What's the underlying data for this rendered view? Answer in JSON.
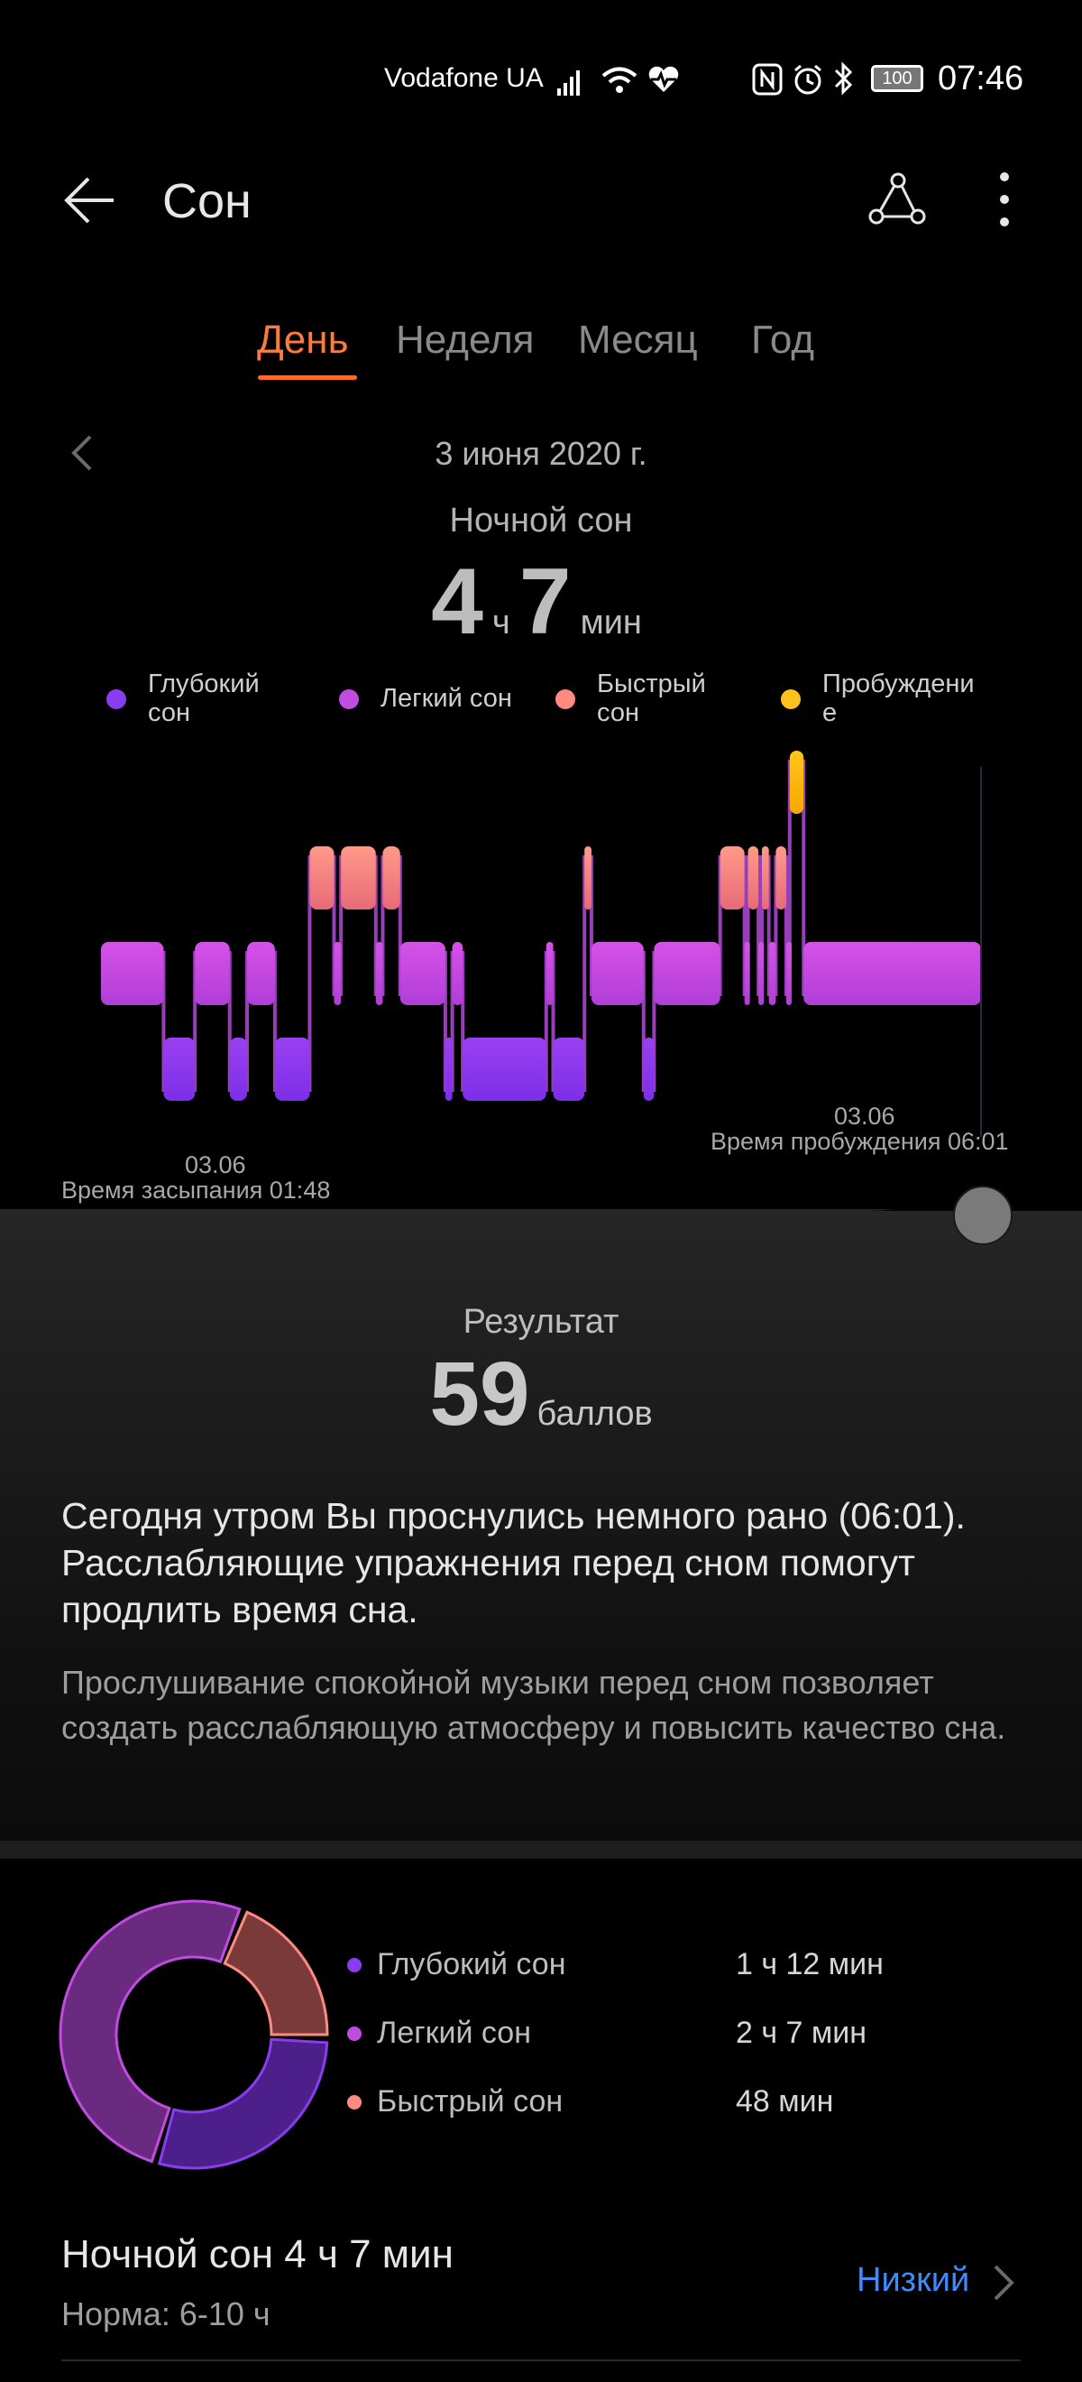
{
  "status_bar": {
    "carrier": "Vodafone UA",
    "battery": "100",
    "time": "07:46",
    "icons": [
      "signal-icon",
      "wifi-icon",
      "heart-rate-icon",
      "nfc-icon",
      "alarm-icon",
      "bluetooth-icon",
      "battery-icon"
    ]
  },
  "header": {
    "title": "Сон"
  },
  "tabs": [
    {
      "label": "День",
      "active": true
    },
    {
      "label": "Неделя",
      "active": false
    },
    {
      "label": "Месяц",
      "active": false
    },
    {
      "label": "Год",
      "active": false
    }
  ],
  "summary": {
    "date": "3 июня 2020 г.",
    "subtitle": "Ночной сон",
    "hours": "4",
    "hours_unit": "ч",
    "minutes": "7",
    "minutes_unit": "мин"
  },
  "legend": [
    {
      "label": "Глубокий сон",
      "color": "#8a3cf0"
    },
    {
      "label": "Легкий сон",
      "color": "#c04ce0"
    },
    {
      "label": "Быстрый сон",
      "color": "#ff8a80"
    },
    {
      "label": "Пробуждение",
      "color": "#ffc21a"
    }
  ],
  "chart_data": {
    "type": "area",
    "title": "",
    "stages": [
      "Пробуждение",
      "Быстрый сон",
      "Легкий сон",
      "Глубокий сон"
    ],
    "start": {
      "date": "03.06",
      "label": "Время засыпания 01:48",
      "time": "01:48"
    },
    "end": {
      "date": "03.06",
      "label": "Время пробуждения 06:01",
      "time": "06:01"
    },
    "segments": [
      {
        "stage": "Легкий сон",
        "from": "01:48",
        "to": "02:06"
      },
      {
        "stage": "Глубокий сон",
        "from": "02:06",
        "to": "02:15"
      },
      {
        "stage": "Легкий сон",
        "from": "02:15",
        "to": "02:25"
      },
      {
        "stage": "Глубокий сон",
        "from": "02:25",
        "to": "02:30"
      },
      {
        "stage": "Легкий сон",
        "from": "02:30",
        "to": "02:38"
      },
      {
        "stage": "Глубокий сон",
        "from": "02:38",
        "to": "02:48"
      },
      {
        "stage": "Быстрый сон",
        "from": "02:48",
        "to": "02:55"
      },
      {
        "stage": "Легкий сон",
        "from": "02:55",
        "to": "02:57"
      },
      {
        "stage": "Быстрый сон",
        "from": "02:57",
        "to": "03:07"
      },
      {
        "stage": "Легкий сон",
        "from": "03:07",
        "to": "03:09"
      },
      {
        "stage": "Быстрый сон",
        "from": "03:09",
        "to": "03:14"
      },
      {
        "stage": "Легкий сон",
        "from": "03:14",
        "to": "03:27"
      },
      {
        "stage": "Глубокий сон",
        "from": "03:27",
        "to": "03:29"
      },
      {
        "stage": "Легкий сон",
        "from": "03:29",
        "to": "03:32"
      },
      {
        "stage": "Глубокий сон",
        "from": "03:32",
        "to": "03:56"
      },
      {
        "stage": "Легкий сон",
        "from": "03:56",
        "to": "03:58"
      },
      {
        "stage": "Глубокий сон",
        "from": "03:58",
        "to": "04:07"
      },
      {
        "stage": "Быстрый сон",
        "from": "04:07",
        "to": "04:09"
      },
      {
        "stage": "Легкий сон",
        "from": "04:09",
        "to": "04:24"
      },
      {
        "stage": "Глубокий сон",
        "from": "04:24",
        "to": "04:27"
      },
      {
        "stage": "Легкий сон",
        "from": "04:27",
        "to": "04:46"
      },
      {
        "stage": "Быстрый сон",
        "from": "04:46",
        "to": "04:53"
      },
      {
        "stage": "Легкий сон",
        "from": "04:53",
        "to": "04:54"
      },
      {
        "stage": "Быстрый сон",
        "from": "04:54",
        "to": "04:57"
      },
      {
        "stage": "Легкий сон",
        "from": "04:57",
        "to": "04:58"
      },
      {
        "stage": "Быстрый сон",
        "from": "04:58",
        "to": "05:00"
      },
      {
        "stage": "Легкий сон",
        "from": "05:00",
        "to": "05:02"
      },
      {
        "stage": "Быстрый сон",
        "from": "05:02",
        "to": "05:05"
      },
      {
        "stage": "Легкий сон",
        "from": "05:05",
        "to": "05:06"
      },
      {
        "stage": "Пробуждение",
        "from": "05:06",
        "to": "05:10"
      },
      {
        "stage": "Легкий сон",
        "from": "05:10",
        "to": "06:01"
      }
    ]
  },
  "result": {
    "label": "Результат",
    "score": "59",
    "unit": "баллов",
    "advice": "Сегодня утром Вы проснулись немного рано (06:01). Расслабляющие упражнения перед сном помогут продлить время сна.",
    "tip": "Прослушивание спокойной музыки перед сном позволяет создать расслабляющую атмосферу и повысить качество сна."
  },
  "breakdown": [
    {
      "label": "Глубокий сон",
      "value": "1 ч 12 мин",
      "minutes": 72,
      "color": "#8a3cf0",
      "ring": "#4d1f8a"
    },
    {
      "label": "Легкий сон",
      "value": "2 ч 7 мин",
      "minutes": 127,
      "color": "#c04ce0",
      "ring": "#6a2a80"
    },
    {
      "label": "Быстрый сон",
      "value": "48 мин",
      "minutes": 48,
      "color": "#ff8a80",
      "ring": "#7a3a3a"
    }
  ],
  "footer": {
    "title": "Ночной сон  4 ч 7 мин",
    "norm": "Норма: 6-10 ч",
    "level": "Низкий"
  }
}
